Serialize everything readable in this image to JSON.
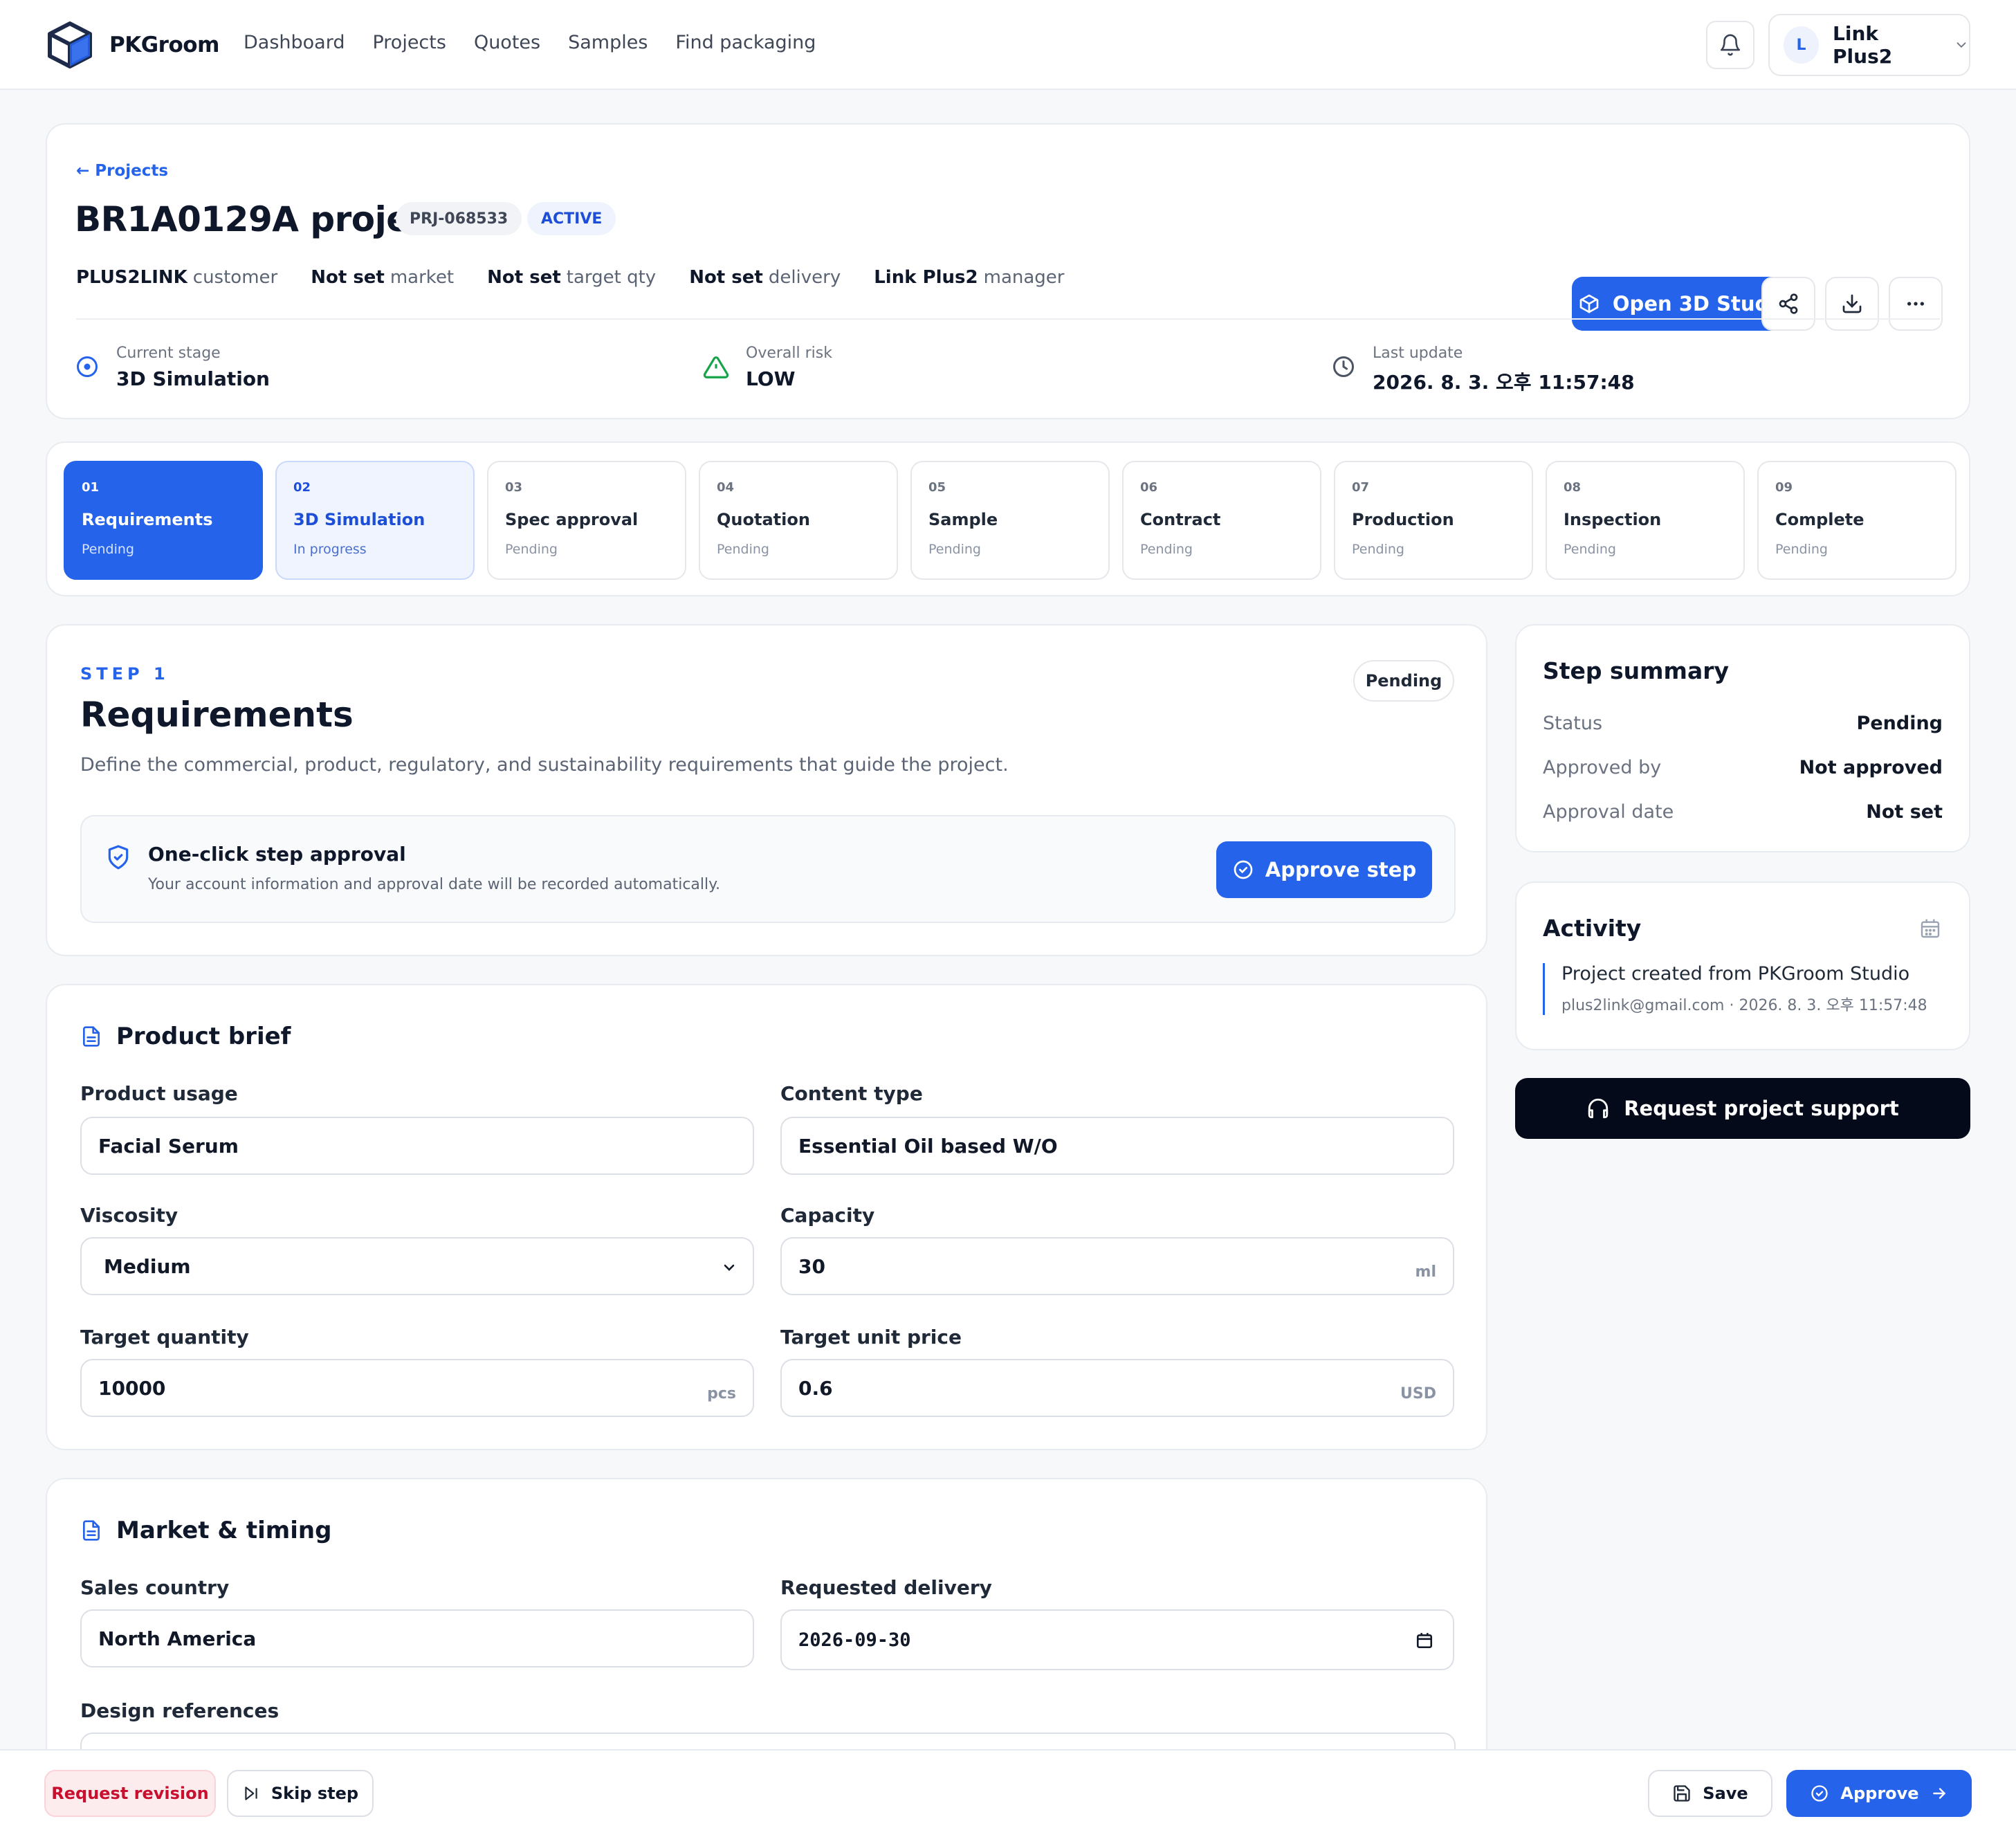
{
  "nav": {
    "brand": "PKGroom",
    "links": [
      "Dashboard",
      "Projects",
      "Quotes",
      "Samples",
      "Find packaging"
    ],
    "user": {
      "initial": "L",
      "name": "Link Plus2"
    }
  },
  "project": {
    "back_label": "Projects",
    "title": "BR1A0129A project",
    "code": "PRJ-068533",
    "status": "ACTIVE",
    "meta": [
      {
        "value": "PLUS2LINK",
        "label": "customer"
      },
      {
        "value": "Not set",
        "label": "market"
      },
      {
        "value": "Not set",
        "label": "target qty"
      },
      {
        "value": "Not set",
        "label": "delivery"
      },
      {
        "value": "Link Plus2",
        "label": "manager"
      }
    ],
    "stats": {
      "stage": {
        "label": "Current stage",
        "value": "3D Simulation"
      },
      "risk": {
        "label": "Overall risk",
        "value": "LOW"
      },
      "update": {
        "label": "Last update",
        "value": "2026. 8. 3. 오후 11:57:48"
      }
    },
    "open_3d_label": "Open 3D Studio"
  },
  "steps": [
    {
      "num": "01",
      "name": "Requirements",
      "status": "Pending"
    },
    {
      "num": "02",
      "name": "3D Simulation",
      "status": "In progress"
    },
    {
      "num": "03",
      "name": "Spec approval",
      "status": "Pending"
    },
    {
      "num": "04",
      "name": "Quotation",
      "status": "Pending"
    },
    {
      "num": "05",
      "name": "Sample",
      "status": "Pending"
    },
    {
      "num": "06",
      "name": "Contract",
      "status": "Pending"
    },
    {
      "num": "07",
      "name": "Production",
      "status": "Pending"
    },
    {
      "num": "08",
      "name": "Inspection",
      "status": "Pending"
    },
    {
      "num": "09",
      "name": "Complete",
      "status": "Pending"
    }
  ],
  "requirements": {
    "eyebrow": "STEP 1",
    "title": "Requirements",
    "description": "Define the commercial, product, regulatory, and sustainability requirements that guide the project.",
    "status": "Pending",
    "approval": {
      "title": "One-click step approval",
      "subtitle": "Your account information and approval date will be recorded automatically.",
      "button": "Approve step"
    }
  },
  "brief": {
    "title": "Product brief",
    "product_usage": {
      "label": "Product usage",
      "value": "Facial Serum"
    },
    "content_type": {
      "label": "Content type",
      "value": "Essential Oil based W/O"
    },
    "viscosity": {
      "label": "Viscosity",
      "value": "Medium"
    },
    "capacity": {
      "label": "Capacity",
      "value": "30",
      "unit": "ml"
    },
    "target_quantity": {
      "label": "Target quantity",
      "value": "10000",
      "unit": "pcs"
    },
    "target_unit_price": {
      "label": "Target unit price",
      "value": "0.6",
      "unit": "USD"
    }
  },
  "market": {
    "title": "Market & timing",
    "sales_country": {
      "label": "Sales country",
      "value": "North America"
    },
    "requested_delivery": {
      "label": "Requested delivery",
      "value": "2026-09-30"
    },
    "design_references": {
      "label": "Design references"
    }
  },
  "summary": {
    "title": "Step summary",
    "rows": [
      {
        "k": "Status",
        "v": "Pending"
      },
      {
        "k": "Approved by",
        "v": "Not approved"
      },
      {
        "k": "Approval date",
        "v": "Not set"
      }
    ]
  },
  "activity": {
    "title": "Activity",
    "items": [
      {
        "text": "Project created from PKGroom Studio",
        "meta": "plus2link@gmail.com · 2026. 8. 3. 오후 11:57:48"
      }
    ]
  },
  "support_label": "Request project support",
  "actions": {
    "revision": "Request revision",
    "skip": "Skip step",
    "save": "Save",
    "approve": "Approve"
  },
  "colors": {
    "primary": "#2563eb",
    "dark": "#050a1a",
    "danger": "#c8102e",
    "success": "#16a34a"
  }
}
